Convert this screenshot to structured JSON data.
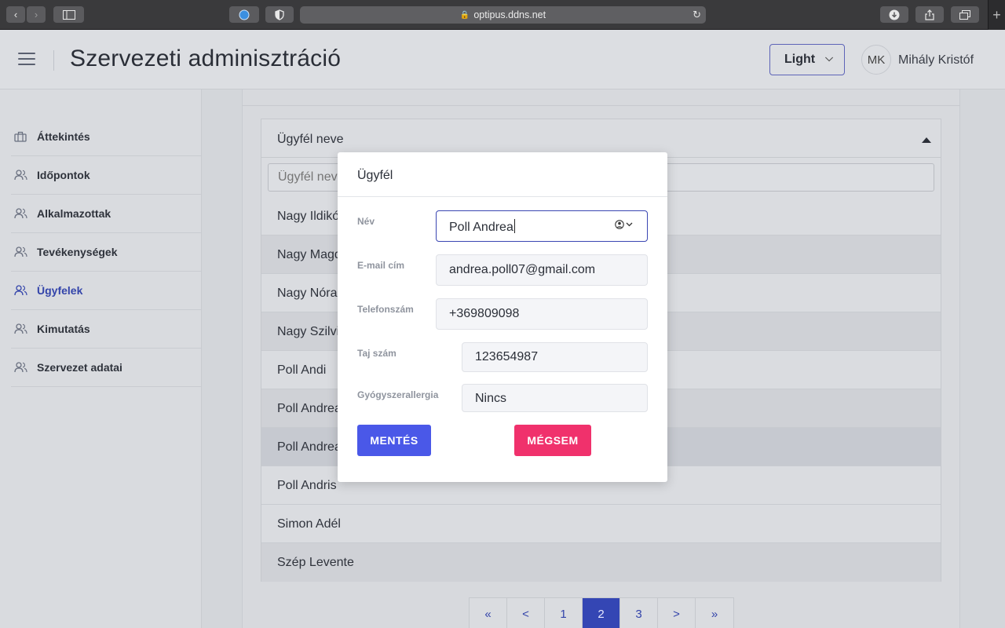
{
  "browser": {
    "url": "optipus.ddns.net"
  },
  "header": {
    "title": "Szervezeti adminisztráció",
    "theme_value": "Light",
    "avatar_initials": "MK",
    "user_name": "Mihály Kristóf"
  },
  "sidebar": {
    "items": [
      {
        "label": "Áttekintés",
        "icon": "briefcase-icon"
      },
      {
        "label": "Időpontok",
        "icon": "users-icon"
      },
      {
        "label": "Alkalmazottak",
        "icon": "users-icon"
      },
      {
        "label": "Tevékenységek",
        "icon": "users-icon"
      },
      {
        "label": "Ügyfelek",
        "icon": "users-icon",
        "active": true
      },
      {
        "label": "Kimutatás",
        "icon": "users-icon"
      },
      {
        "label": "Szervezet adatai",
        "icon": "users-icon"
      }
    ]
  },
  "list": {
    "header": "Ügyfél neve",
    "filter_placeholder": "Ügyfél neve",
    "rows": [
      "Nagy Ildikó",
      "Nagy Magd",
      "Nagy Nóra",
      "Nagy Szilvia",
      "Poll Andi",
      "Poll Andrea",
      "Poll Andrea",
      "Poll Andris",
      "Simon Adél",
      "Szép Levente"
    ]
  },
  "pagination": [
    "«",
    "<",
    "1",
    "2",
    "3",
    ">",
    "»"
  ],
  "pagination_active": "2",
  "modal": {
    "title": "Ügyfél",
    "fields": {
      "name_label": "Név",
      "name_value": "Poll Andrea",
      "email_label": "E-mail cím",
      "email_value": "andrea.poll07@gmail.com",
      "phone_label": "Telefonszám",
      "phone_value": "+369809098",
      "taj_label": "Taj szám",
      "taj_value": "123654987",
      "allergy_label": "Gyógyszerallergia",
      "allergy_value": "Nincs"
    },
    "save_label": "MENTÉS",
    "cancel_label": "MÉGSEM"
  },
  "colors": {
    "primary": "#4a58e8",
    "danger": "#f0316c",
    "active_nav": "#3344aa"
  }
}
